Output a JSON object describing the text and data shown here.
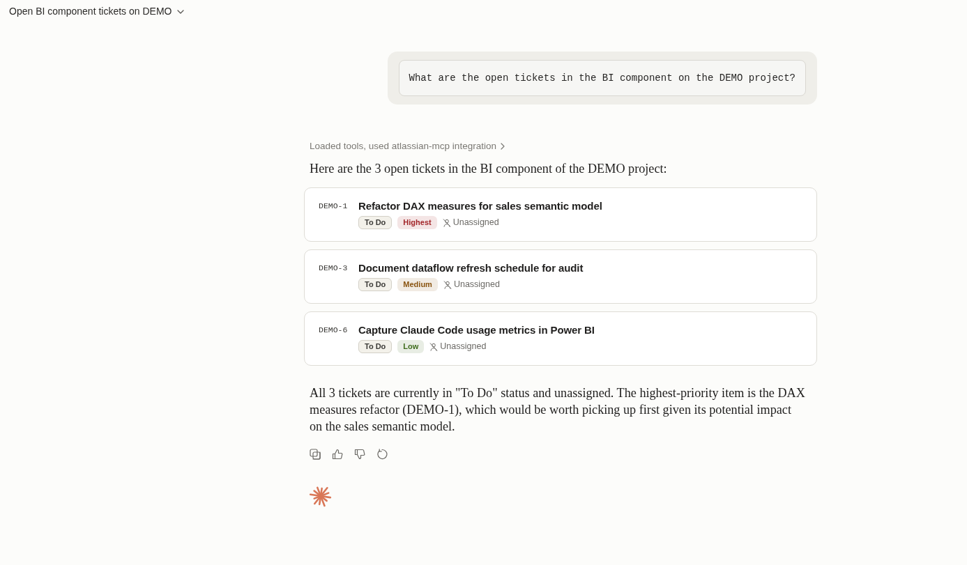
{
  "header": {
    "title": "Open BI component tickets on DEMO"
  },
  "user_message": {
    "text": "What are the open tickets in the BI component on the DEMO project?"
  },
  "assistant": {
    "tool_summary": "Loaded tools, used atlassian-mcp integration",
    "intro": "Here are the 3 open tickets in the BI component of the DEMO project:",
    "tickets": [
      {
        "key": "DEMO-1",
        "title": "Refactor DAX measures for sales semantic model",
        "status": "To Do",
        "priority": {
          "label": "Highest",
          "color": "#a3262a"
        },
        "assignee": "Unassigned"
      },
      {
        "key": "DEMO-3",
        "title": "Document dataflow refresh schedule for audit",
        "status": "To Do",
        "priority": {
          "label": "Medium",
          "color": "#8a5512"
        },
        "assignee": "Unassigned"
      },
      {
        "key": "DEMO-6",
        "title": "Capture Claude Code usage metrics in Power BI",
        "status": "To Do",
        "priority": {
          "label": "Low",
          "color": "#3f6d1e"
        },
        "assignee": "Unassigned"
      }
    ],
    "summary": "All 3 tickets are currently in \"To Do\" status and unassigned. The highest-priority item is the DAX measures refactor (DEMO-1), which would be worth picking up first given its potential impact on the sales semantic model."
  }
}
